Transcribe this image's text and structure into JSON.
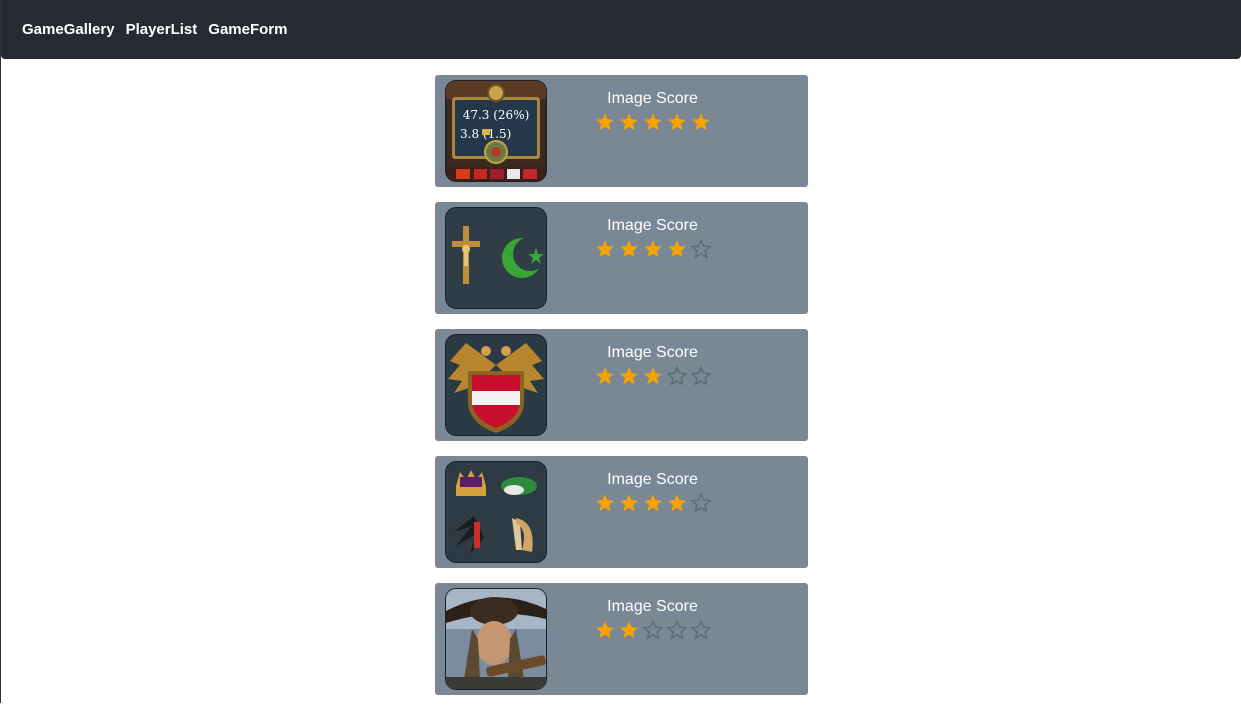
{
  "nav": {
    "links": [
      "GameGallery",
      "PlayerList",
      "GameForm"
    ]
  },
  "colors": {
    "navbar": "#262b33",
    "card": "#7a8895",
    "star_filled": "#f5a300",
    "star_empty_stroke": "#5d6a76"
  },
  "cards": [
    {
      "image": "statistics-panel-icon",
      "panel_line_1": "47.3  (26%)",
      "panel_line_2": "3.8    (1.5)",
      "score_label": "Image Score",
      "rating": 5,
      "max_rating": 5
    },
    {
      "image": "cross-and-crescent-icon",
      "score_label": "Image Score",
      "rating": 4,
      "max_rating": 5
    },
    {
      "image": "double-eagle-shield-icon",
      "score_label": "Image Score",
      "rating": 3,
      "max_rating": 5
    },
    {
      "image": "crown-feathers-harp-icon",
      "score_label": "Image Score",
      "rating": 4,
      "max_rating": 5
    },
    {
      "image": "musketeer-portrait",
      "score_label": "Image Score",
      "rating": 2,
      "max_rating": 5
    }
  ]
}
